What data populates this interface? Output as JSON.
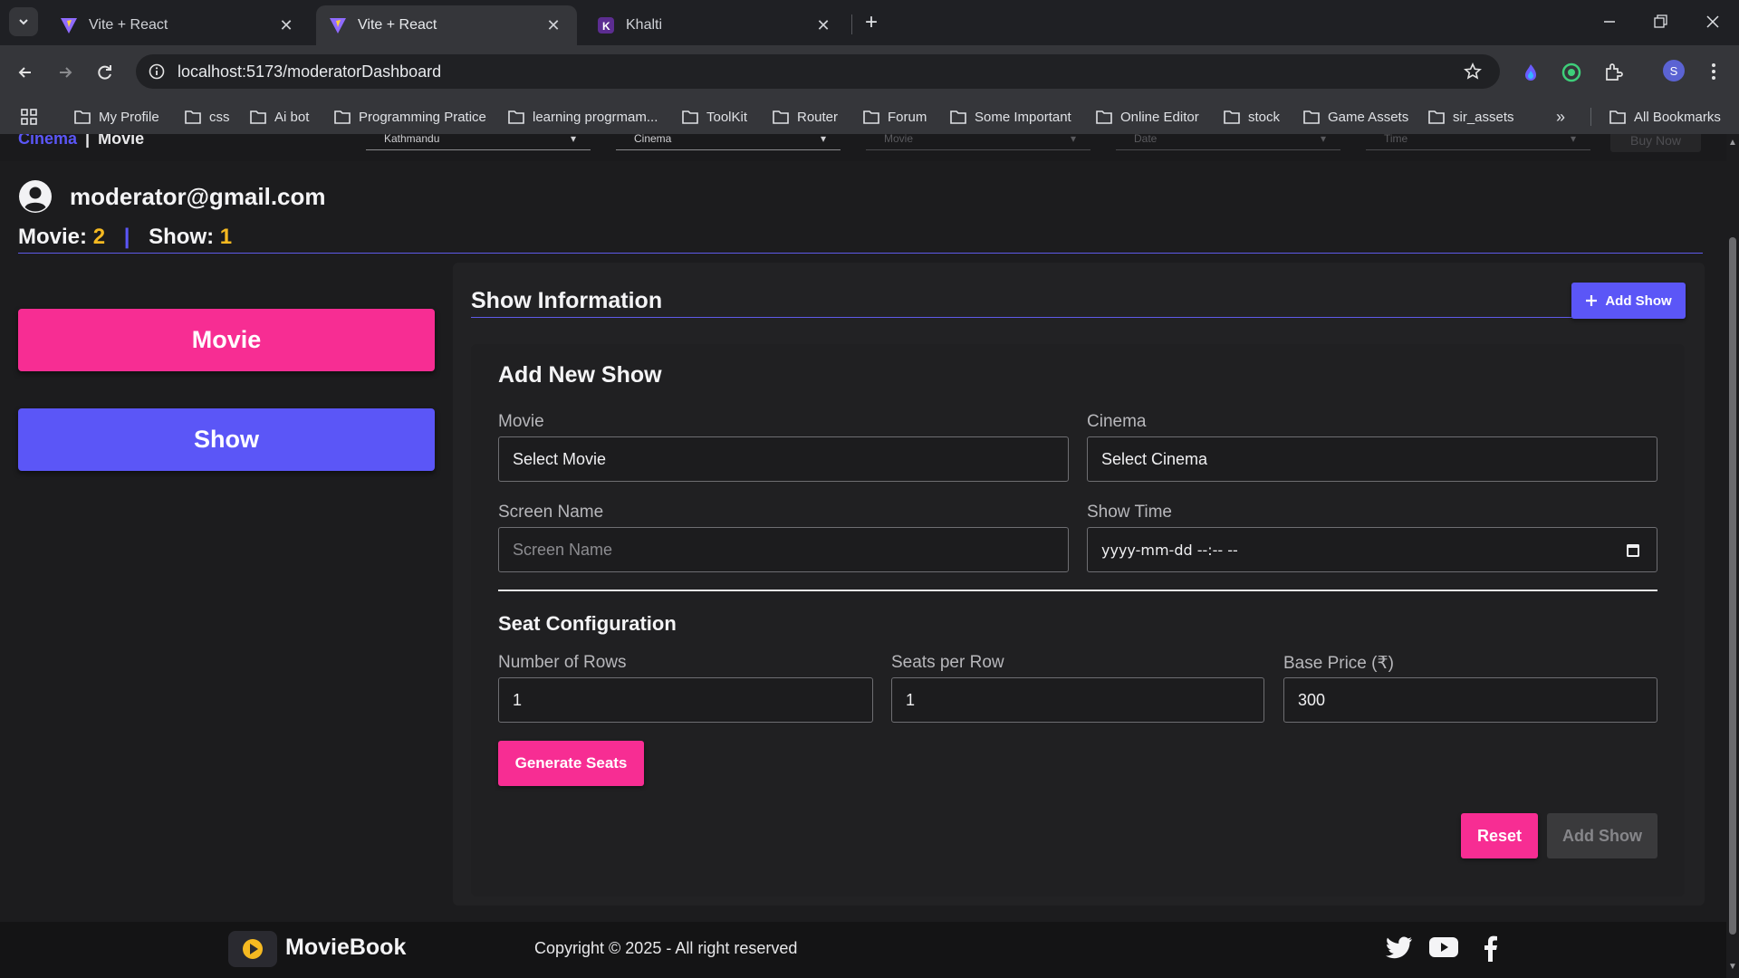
{
  "browser": {
    "tabs": [
      {
        "title": "Vite + React",
        "active": false
      },
      {
        "title": "Vite + React",
        "active": true
      },
      {
        "title": "Khalti",
        "active": false
      }
    ],
    "url": "localhost:5173/moderatorDashboard",
    "profile_initial": "S",
    "bookmarks": [
      "My Profile",
      "css",
      "Ai bot",
      "Programming Pratice",
      "learning progrmam...",
      "ToolKit",
      "Router",
      "Forum",
      "Some Important",
      "Online Editor",
      "stock",
      "Game Assets",
      "sir_assets"
    ],
    "all_bookmarks": "All Bookmarks",
    "more": "»"
  },
  "topnav": {
    "breadcrumb_cinema": "Cinema",
    "breadcrumb_sep": "|",
    "breadcrumb_movie": "Movie",
    "location": "Kathmandu",
    "cinema": "Cinema",
    "movie": "Movie",
    "date": "Date",
    "time": "Time",
    "buy_now": "Buy Now"
  },
  "profile": {
    "email": "moderator@gmail.com",
    "movie_label": "Movie:",
    "movie_count": "2",
    "sep": "|",
    "show_label": "Show:",
    "show_count": "1"
  },
  "sidebar": {
    "movie": "Movie",
    "show": "Show"
  },
  "panel": {
    "title": "Show Information",
    "add_show_button": "Add Show",
    "form_title": "Add New Show",
    "movie_label": "Movie",
    "movie_value": "Select Movie",
    "cinema_label": "Cinema",
    "cinema_value": "Select Cinema",
    "screen_label": "Screen Name",
    "screen_placeholder": "Screen Name",
    "showtime_label": "Show Time",
    "showtime_value": "yyyy-mm-dd --:-- --",
    "seat_title": "Seat Configuration",
    "rows_label": "Number of Rows",
    "rows_value": "1",
    "seats_label": "Seats per Row",
    "seats_value": "1",
    "price_label": "Base Price (₹)",
    "price_value": "300",
    "generate_button": "Generate Seats",
    "reset_button": "Reset",
    "submit_button": "Add Show"
  },
  "footer": {
    "brand": "MovieBook",
    "copyright": "Copyright © 2025 - All right reserved"
  },
  "colors": {
    "pink": "#f72d93",
    "indigo": "#5b56f7",
    "gold": "#f5b921"
  }
}
